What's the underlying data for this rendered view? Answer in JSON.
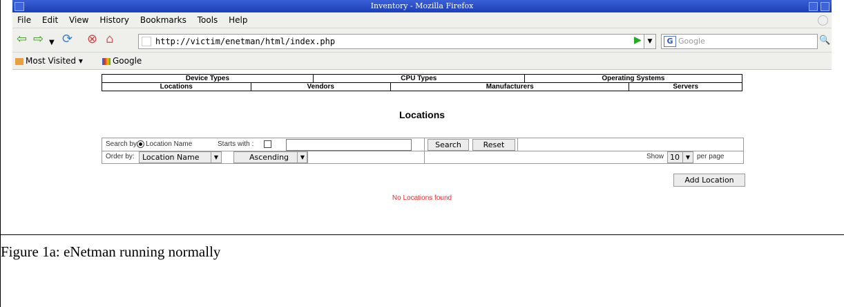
{
  "window": {
    "title": "Inventory - Mozilla Firefox"
  },
  "menu": [
    "File",
    "Edit",
    "View",
    "History",
    "Bookmarks",
    "Tools",
    "Help"
  ],
  "toolbar": {
    "url": "http://victim/enetman/html/index.php",
    "search_placeholder": "Google"
  },
  "bookmarks": {
    "most_visited": "Most Visited ▾",
    "google": "Google"
  },
  "nav": {
    "row1": [
      "Device Types",
      "CPU Types",
      "Operating Systems"
    ],
    "row2": [
      "Locations",
      "Vendors",
      "Manufacturers",
      "Servers"
    ]
  },
  "page": {
    "heading": "Locations",
    "search_by_label": "Search by:",
    "radio_label": "Location Name",
    "starts_with_label": "Starts with :",
    "search_button": "Search",
    "reset_button": "Reset",
    "order_by_label": "Order by:",
    "order_field": "Location Name",
    "order_direction": "Ascending",
    "show_label": "Show",
    "per_page_value": "10",
    "per_page_label": "per page",
    "add_button": "Add Location",
    "empty_message": "No Locations found"
  },
  "caption": "Figure 1a: eNetman running normally"
}
